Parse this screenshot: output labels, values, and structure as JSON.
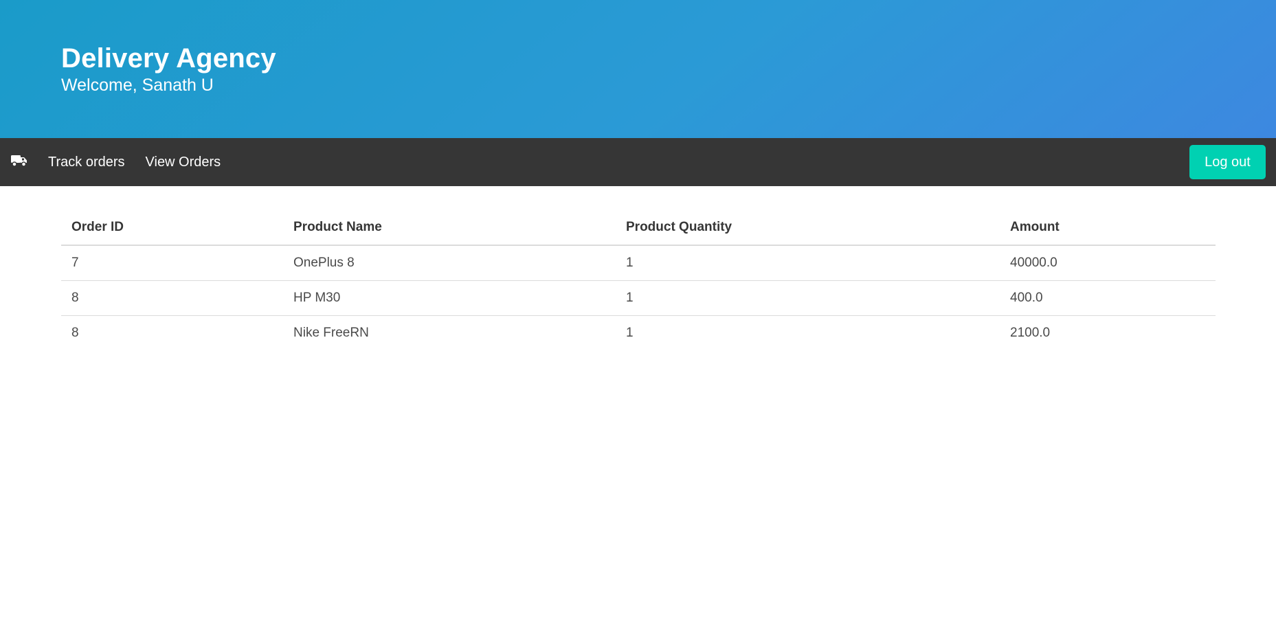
{
  "hero": {
    "title": "Delivery Agency",
    "subtitle": "Welcome, Sanath U"
  },
  "navbar": {
    "brand_icon": "truck-icon",
    "items": [
      {
        "label": "Track orders"
      },
      {
        "label": "View Orders"
      }
    ],
    "logout_label": "Log out"
  },
  "orders_table": {
    "headers": [
      "Order ID",
      "Product Name",
      "Product Quantity",
      "Amount"
    ],
    "rows": [
      [
        "7",
        "OnePlus 8",
        "1",
        "40000.0"
      ],
      [
        "8",
        "HP M30",
        "1",
        "400.0"
      ],
      [
        "8",
        "Nike FreeRN",
        "1",
        "2100.0"
      ]
    ]
  },
  "colors": {
    "hero_gradient_start": "#1a9bc9",
    "hero_gradient_end": "#3d88e0",
    "navbar": "#363636",
    "logout_button": "#00d1b2"
  }
}
